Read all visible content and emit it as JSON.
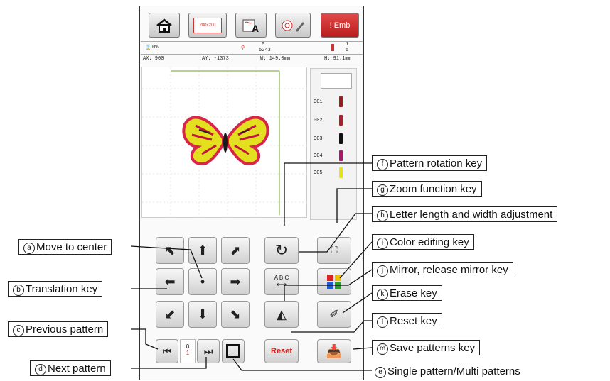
{
  "topbar": {
    "hoop_label": "200x200",
    "emb_label": "Emb"
  },
  "status": {
    "percent": "0%",
    "stitches_top": "0",
    "stitches_total": "6243",
    "thread_top": "1",
    "thread_total": "5",
    "ax": "AX:   900",
    "ay": "AY:  -1373",
    "w": "W:   149.0mm",
    "h": "H:   91.1mm"
  },
  "threads": [
    {
      "num": "001",
      "color": "#9b1c1c"
    },
    {
      "num": "002",
      "color": "#b01e2a"
    },
    {
      "num": "003",
      "color": "#111111"
    },
    {
      "num": "004",
      "color": "#b0156a"
    },
    {
      "num": "005",
      "color": "#e4e412"
    }
  ],
  "counter": {
    "current": "0",
    "total": "1"
  },
  "keys": {
    "letter": "A B C",
    "reset": "Reset"
  },
  "callouts": {
    "a": {
      "letter": "a",
      "text": "Move to center"
    },
    "b": {
      "letter": "b",
      "text": "Translation key"
    },
    "c": {
      "letter": "c",
      "text": "Previous pattern"
    },
    "d": {
      "letter": "d",
      "text": "Next pattern"
    },
    "e": {
      "letter": "e",
      "text": "Single pattern/Multi patterns"
    },
    "f": {
      "letter": "f",
      "text": "Pattern rotation key"
    },
    "g": {
      "letter": "g",
      "text": "Zoom function key"
    },
    "h": {
      "letter": "h",
      "text": "Letter length and width adjustment"
    },
    "i": {
      "letter": "i",
      "text": "Color editing key"
    },
    "j": {
      "letter": "j",
      "text": "Mirror, release mirror key"
    },
    "k": {
      "letter": "k",
      "text": "Erase key"
    },
    "l": {
      "letter": "l",
      "text": "Reset key"
    },
    "m": {
      "letter": "m",
      "text": "Save patterns key"
    }
  }
}
